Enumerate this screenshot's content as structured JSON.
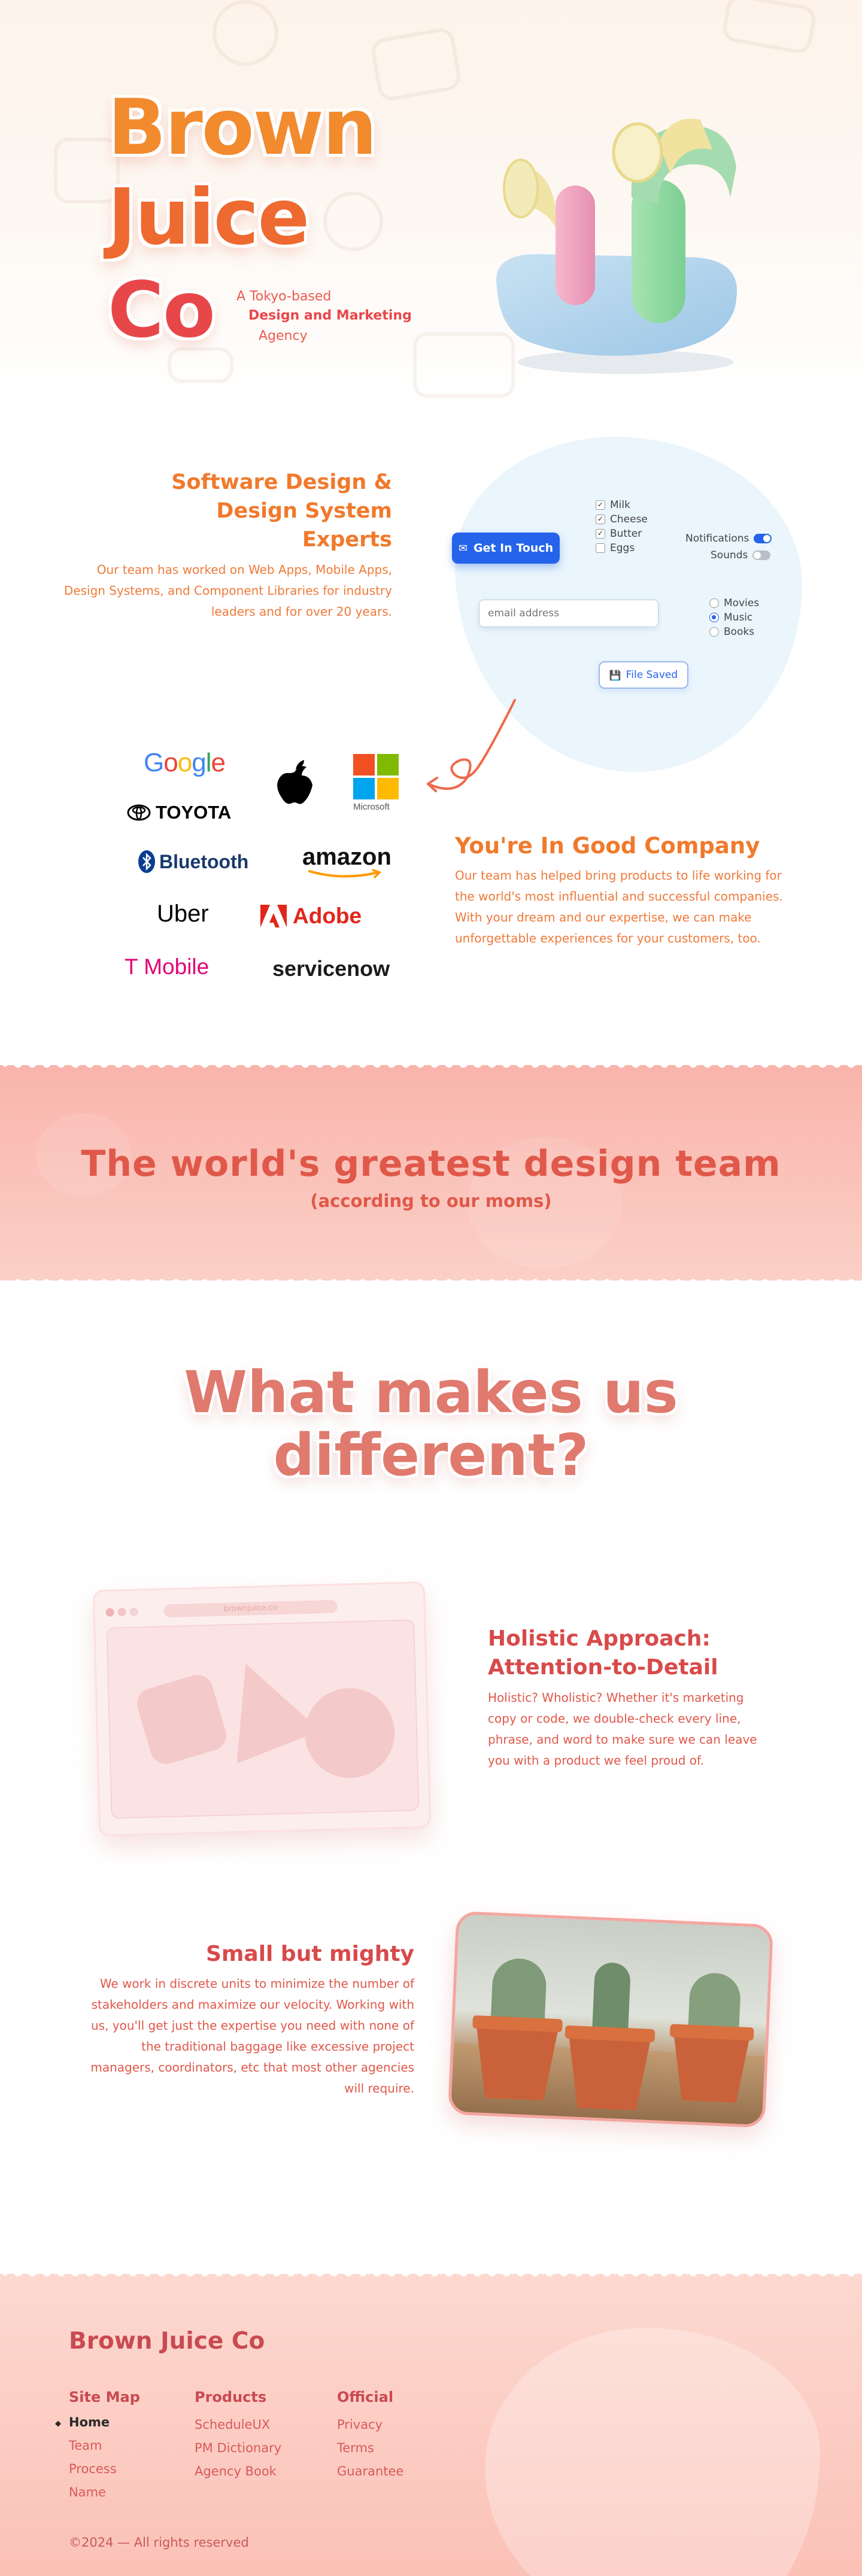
{
  "hero": {
    "brand_line_1": "Brown",
    "brand_line_2": "Juice",
    "brand_line_3": "Co",
    "tagline_1": "A Tokyo-based",
    "tagline_2": "Design and Marketing",
    "tagline_3": "Agency"
  },
  "software": {
    "heading_1": "Software Design &",
    "heading_2": "Design System",
    "heading_3": "Experts",
    "body": "Our team has worked on Web Apps, Mobile Apps, Design Systems, and Component Libraries for industry leaders and for over 20 years."
  },
  "ui_demo": {
    "get_in_touch": "Get In Touch",
    "checklist": [
      {
        "label": "Milk",
        "checked": true
      },
      {
        "label": "Cheese",
        "checked": true
      },
      {
        "label": "Butter",
        "checked": true
      },
      {
        "label": "Eggs",
        "checked": false
      }
    ],
    "toggles": [
      {
        "label": "Notifications",
        "on": true
      },
      {
        "label": "Sounds",
        "on": false
      }
    ],
    "email_placeholder": "email address",
    "radios": [
      {
        "label": "Movies",
        "selected": false
      },
      {
        "label": "Music",
        "selected": true
      },
      {
        "label": "Books",
        "selected": false
      }
    ],
    "file_saved": "File Saved"
  },
  "companies": {
    "logos": [
      "Google",
      "TOYOTA",
      "Microsoft",
      "Bluetooth",
      "amazon",
      "Uber",
      "Adobe",
      "T Mobile",
      "servicenow"
    ],
    "heading": "You're In Good Company",
    "body_1": "Our team has helped bring products to life working for the world's most influential and successful companies.",
    "body_2": "With your dream and our expertise, we can make unforgettable experiences for your customers, too."
  },
  "band": {
    "title": "The world's greatest design team",
    "subtitle": "(according to our moms)"
  },
  "different": {
    "title_1": "What makes us",
    "title_2": "different?",
    "browser_url": "brownjuice.co",
    "holistic_heading_1": "Holistic Approach:",
    "holistic_heading_2": "Attention-to-Detail",
    "holistic_body": "Holistic? Wholistic? Whether it's marketing copy or code, we double-check every line, phrase, and word to make sure we can leave you with a product we feel proud of.",
    "small_heading": "Small but mighty",
    "small_body": "We work in discrete units to minimize the number of stakeholders and maximize our velocity. Working with us, you'll get just the expertise you need with none of the traditional baggage like excessive project managers, coordinators, etc that most other agencies will require."
  },
  "footer": {
    "brand": "Brown Juice Co",
    "site_map_title": "Site Map",
    "site_map": [
      "Home",
      "Team",
      "Process",
      "Name"
    ],
    "products_title": "Products",
    "products": [
      "ScheduleUX",
      "PM Dictionary",
      "Agency Book"
    ],
    "official_title": "Official",
    "official": [
      "Privacy",
      "Terms",
      "Guarantee"
    ],
    "copyright": "©2024 — All rights reserved"
  },
  "colors": {
    "brand_orange": "#f07a2c",
    "brand_red": "#e2574c",
    "accent_blue": "#2563eb",
    "band_pink": "#f9b4ac"
  }
}
